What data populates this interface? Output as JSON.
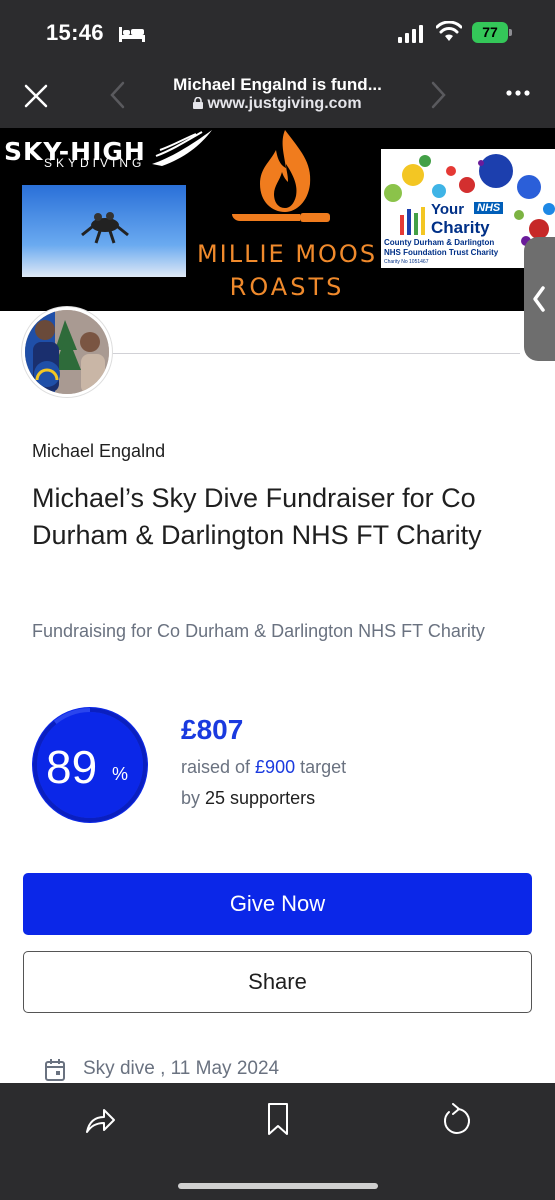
{
  "status_bar": {
    "time": "15:46",
    "battery": "77"
  },
  "browser": {
    "title": "Michael Engalnd is fund...",
    "url": "www.justgiving.com"
  },
  "banner": {
    "sky_title": "SKY-HIGH",
    "sky_sub": "SKYDIVING",
    "millie": "MILLIE MOOS",
    "roasts": "ROASTS",
    "nhs_your": "Your",
    "nhs_badge": "NHS",
    "nhs_charity": "Charity",
    "nhs_line1": "County Durham & Darlington",
    "nhs_line2": "NHS Foundation Trust Charity",
    "nhs_line3": "Charity No 1051467"
  },
  "page": {
    "owner_name": "Michael Engalnd",
    "title": "Michael’s Sky Dive Fundraiser for Co Durham & Darlington NHS FT Charity",
    "fundraising_for": "Fundraising for Co Durham & Darlington NHS FT Charity"
  },
  "progress": {
    "percent": "89",
    "percent_sign": "%",
    "raised": "£807",
    "raised_prefix": "raised of ",
    "target": "£900",
    "raised_suffix": " target",
    "by_prefix": "by ",
    "supporters": "25 supporters"
  },
  "actions": {
    "give_label": "Give Now",
    "share_label": "Share"
  },
  "event": {
    "text": "Sky dive , 11 May 2024"
  },
  "colors": {
    "brand_blue": "#0b27e8",
    "link_blue": "#1a3adf",
    "chrome_dark": "#2c2c2e",
    "battery_green": "#34c759"
  },
  "icons": [
    "bed-icon",
    "signal-icon",
    "wifi-icon",
    "close-icon",
    "back-icon",
    "forward-icon",
    "lock-icon",
    "more-icon",
    "calendar-icon",
    "share-icon",
    "bookmark-icon",
    "reload-icon",
    "chevron-left-icon"
  ]
}
